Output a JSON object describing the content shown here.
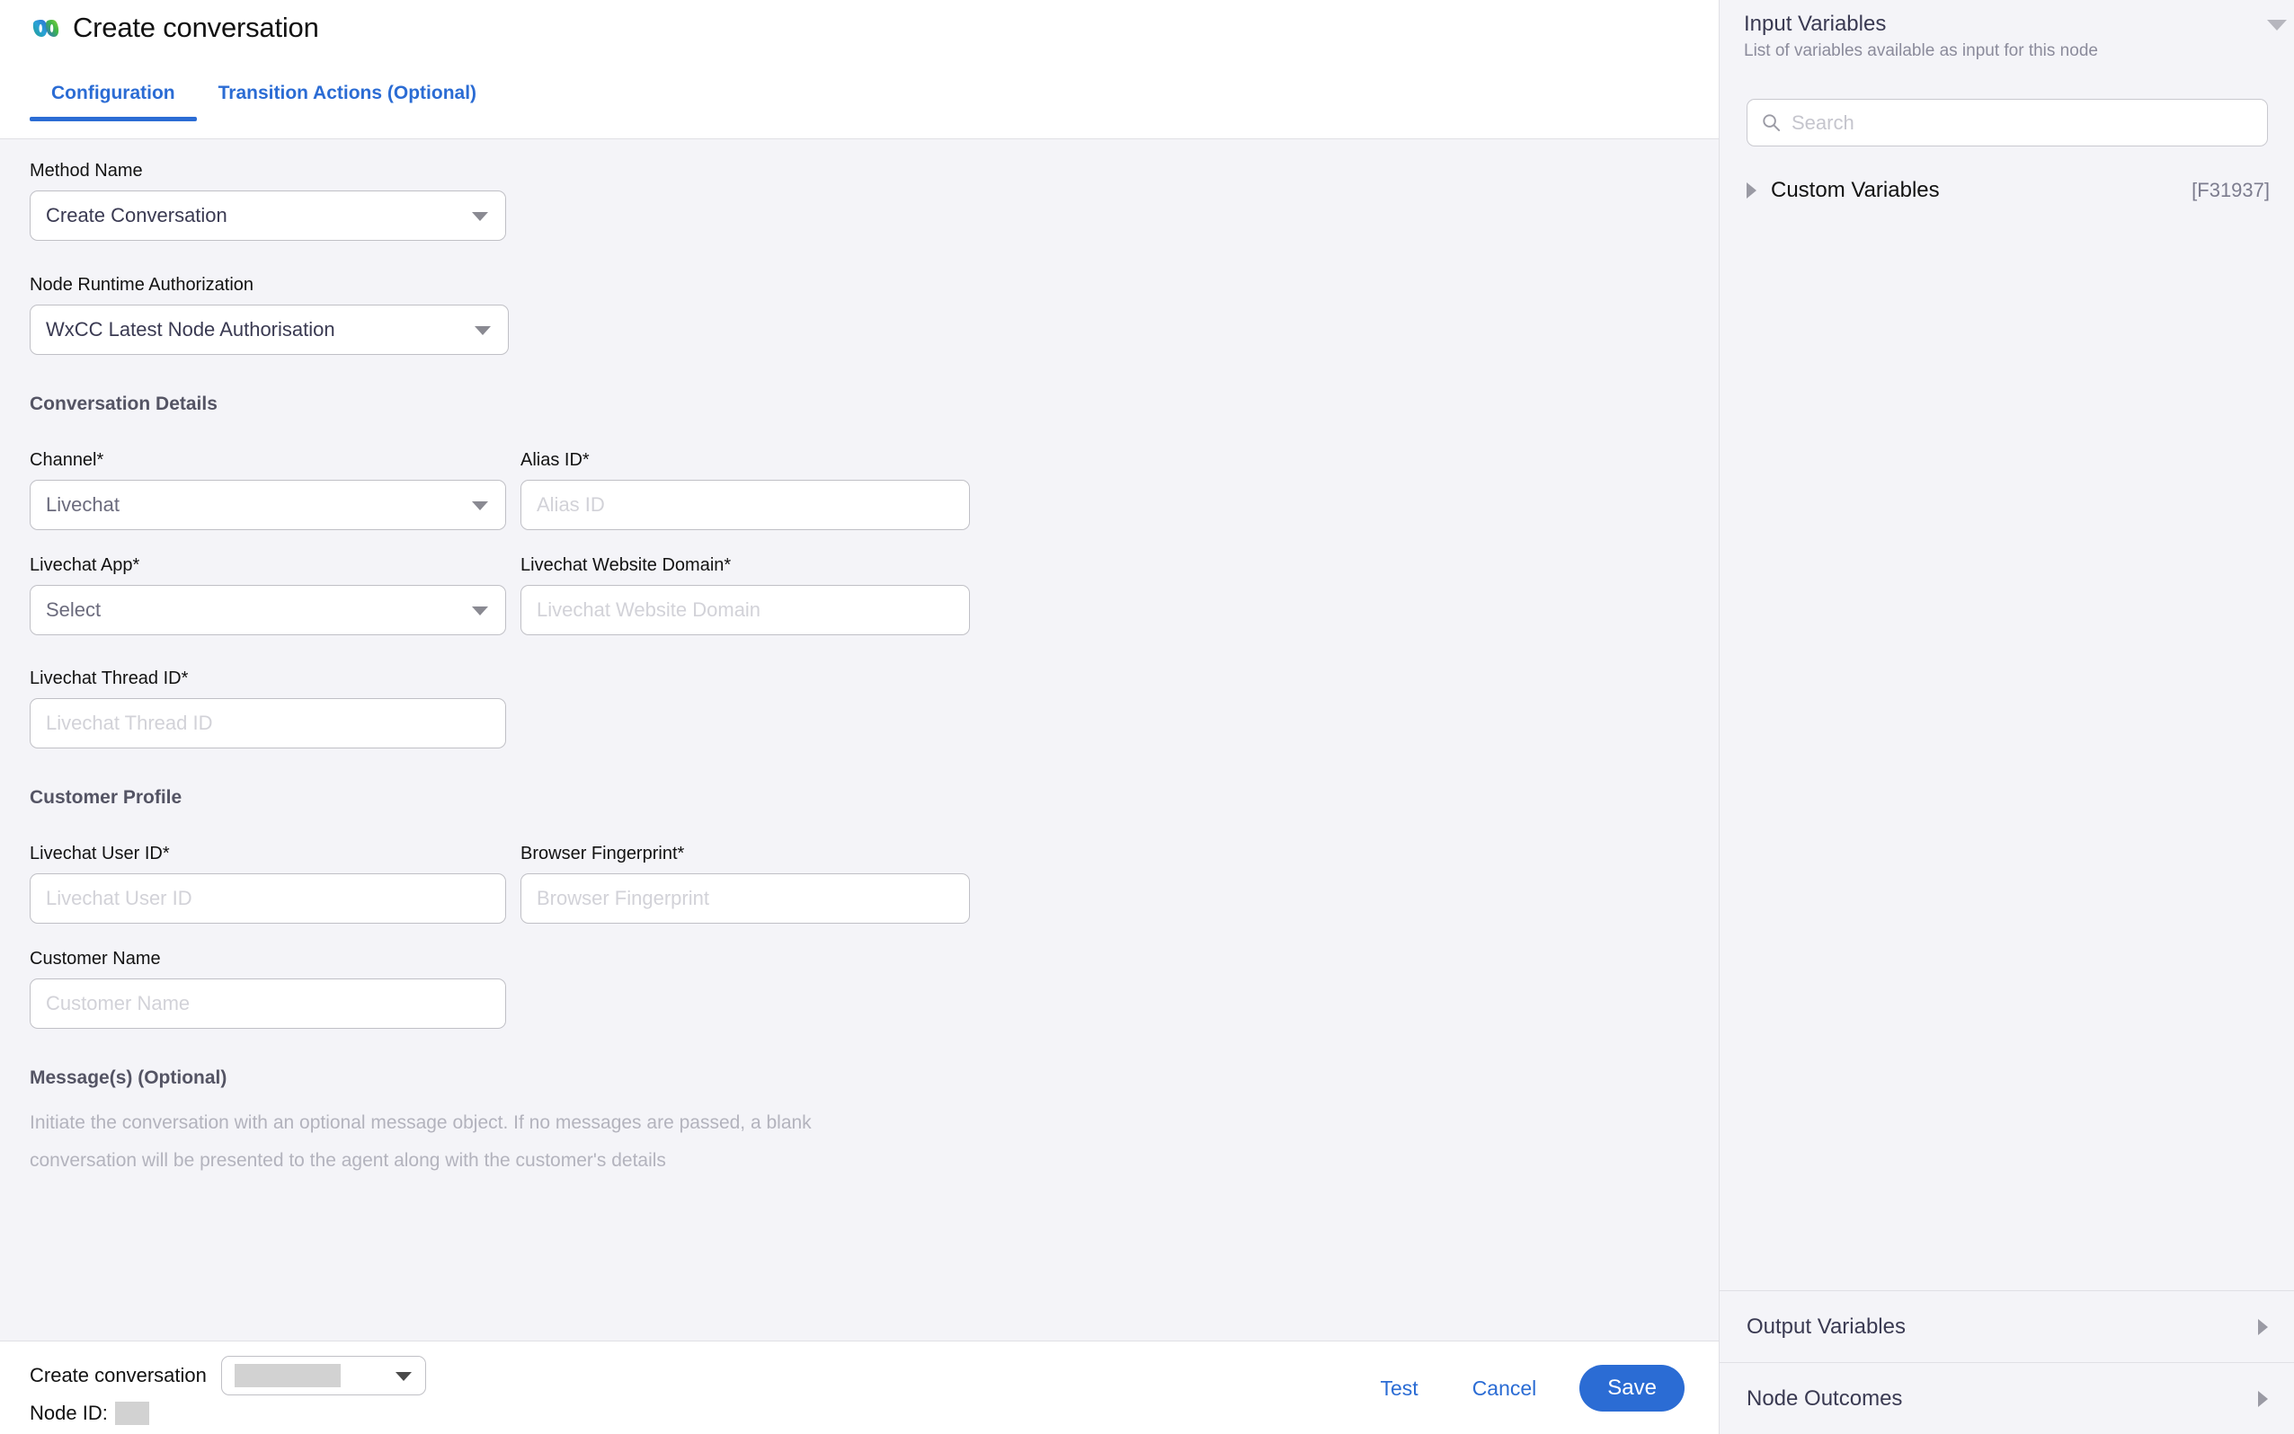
{
  "header": {
    "title": "Create conversation",
    "logo_icon": "webex-logo-icon",
    "tabs": [
      {
        "label": "Configuration",
        "active": true
      },
      {
        "label": "Transition Actions (Optional)",
        "active": false
      }
    ]
  },
  "form": {
    "method_name": {
      "label": "Method Name",
      "value": "Create Conversation",
      "caret_icon": "chevron-down-icon"
    },
    "node_runtime_authorization": {
      "label": "Node Runtime Authorization",
      "value": "WxCC Latest Node Authorisation",
      "caret_icon": "chevron-down-icon"
    },
    "conversation_details": {
      "heading": "Conversation Details",
      "channel": {
        "label": "Channel*",
        "value": "Livechat",
        "caret_icon": "chevron-down-icon"
      },
      "alias_id": {
        "label": "Alias ID*",
        "value": "",
        "placeholder": "Alias ID"
      },
      "livechat_app": {
        "label": "Livechat App*",
        "value": "Select",
        "caret_icon": "chevron-down-icon"
      },
      "livechat_website_domain": {
        "label": "Livechat Website Domain*",
        "value": "",
        "placeholder": "Livechat Website Domain"
      },
      "livechat_thread_id": {
        "label": "Livechat Thread ID*",
        "value": "",
        "placeholder": "Livechat Thread ID"
      }
    },
    "customer_profile": {
      "heading": "Customer Profile",
      "livechat_user_id": {
        "label": "Livechat User ID*",
        "value": "",
        "placeholder": "Livechat User ID"
      },
      "browser_fingerprint": {
        "label": "Browser Fingerprint*",
        "value": "",
        "placeholder": "Browser Fingerprint"
      },
      "customer_name": {
        "label": "Customer Name",
        "value": "",
        "placeholder": "Customer Name"
      }
    },
    "messages": {
      "heading": "Message(s) (Optional)",
      "description": "Initiate the conversation with an optional message object. If no messages are passed, a blank conversation will be presented to the agent along with the customer's details"
    }
  },
  "footer": {
    "node_label": "Create conversation",
    "node_select_value": "",
    "node_select_caret_icon": "chevron-down-icon",
    "node_id_label": "Node ID:",
    "node_id_value": "",
    "test_label": "Test",
    "cancel_label": "Cancel",
    "save_label": "Save"
  },
  "sidebar": {
    "input_variables": {
      "title": "Input Variables",
      "subtitle": "List of variables available as input for this node",
      "collapse_icon": "chevron-down-icon",
      "search": {
        "placeholder": "Search",
        "value": "",
        "icon": "search-icon"
      },
      "custom_variables": {
        "label": "Custom Variables",
        "badge": "[F31937]",
        "expand_icon": "chevron-right-icon"
      }
    },
    "output_variables": {
      "label": "Output Variables",
      "expand_icon": "chevron-right-icon"
    },
    "node_outcomes": {
      "label": "Node Outcomes",
      "expand_icon": "chevron-right-icon"
    }
  },
  "colors": {
    "accent": "#2b6cd4",
    "page_bg": "#f4f4f8",
    "panel_bg": "#ffffff",
    "border": "#c0c0c6",
    "placeholder": "#d2d2d8",
    "muted_text": "#8b8b9b"
  }
}
